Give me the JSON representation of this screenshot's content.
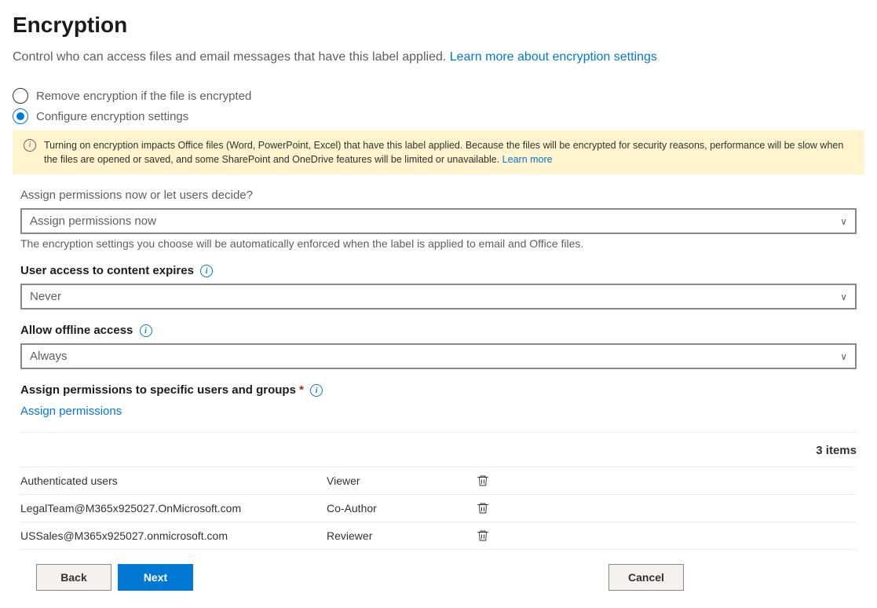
{
  "heading": "Encryption",
  "subtitle_text": "Control who can access files and email messages that have this label applied. ",
  "subtitle_link": "Learn more about encryption settings",
  "radios": {
    "remove": "Remove encryption if the file is encrypted",
    "configure": "Configure encryption settings"
  },
  "banner": {
    "text": "Turning on encryption impacts Office files (Word, PowerPoint, Excel) that have this label applied. Because the files will be encrypted for security reasons, performance will be slow when the files are opened or saved, and some SharePoint and OneDrive features will be limited or unavailable. ",
    "link": "Learn more"
  },
  "assign_mode": {
    "label": "Assign permissions now or let users decide?",
    "value": "Assign permissions now",
    "help": "The encryption settings you choose will be automatically enforced when the label is applied to email and Office files."
  },
  "expires": {
    "label": "User access to content expires",
    "value": "Never"
  },
  "offline": {
    "label": "Allow offline access",
    "value": "Always"
  },
  "assign_specific": {
    "label": "Assign permissions to specific users and groups",
    "action": "Assign permissions"
  },
  "items_count": "3 items",
  "rows": [
    {
      "user": "Authenticated users",
      "role": "Viewer"
    },
    {
      "user": "LegalTeam@M365x925027.OnMicrosoft.com",
      "role": "Co-Author"
    },
    {
      "user": "USSales@M365x925027.onmicrosoft.com",
      "role": "Reviewer"
    }
  ],
  "buttons": {
    "back": "Back",
    "next": "Next",
    "cancel": "Cancel"
  }
}
